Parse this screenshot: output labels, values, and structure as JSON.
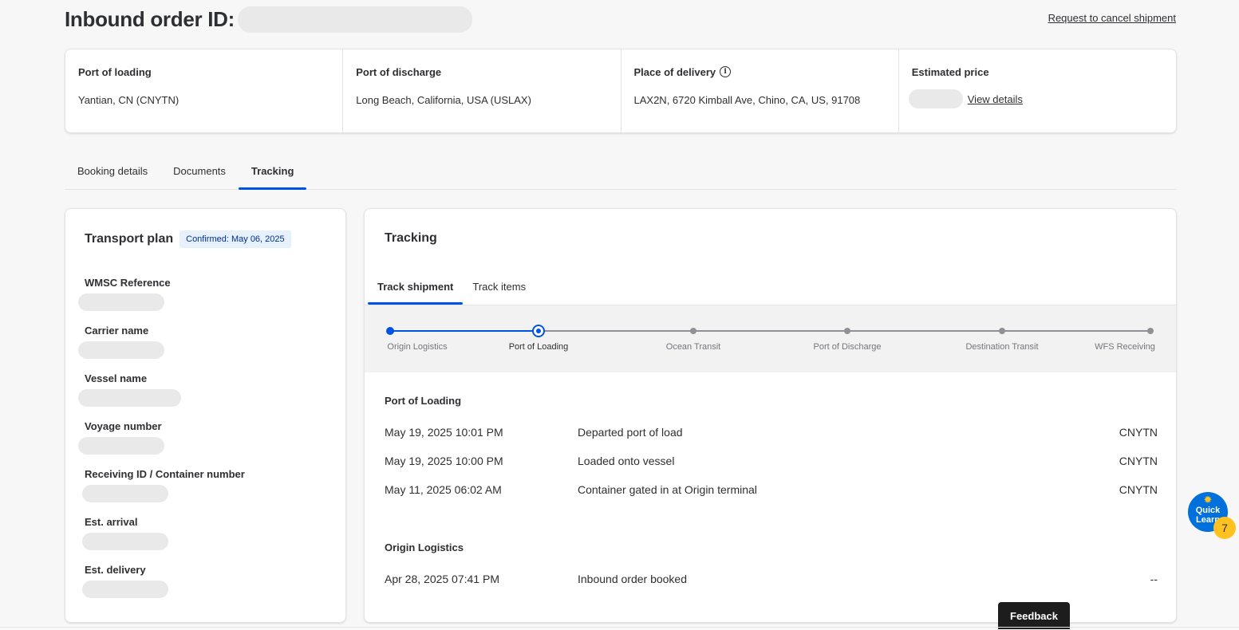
{
  "header": {
    "title": "Inbound order ID:",
    "cancel_link": "Request to cancel shipment"
  },
  "summary": {
    "port_of_loading_label": "Port of loading",
    "port_of_loading_value": "Yantian, CN (CNYTN)",
    "port_of_discharge_label": "Port of discharge",
    "port_of_discharge_value": "Long Beach, California, USA (USLAX)",
    "place_of_delivery_label": "Place of delivery",
    "place_of_delivery_value": "LAX2N, 6720 Kimball Ave, Chino, CA, US, 91708",
    "estimated_price_label": "Estimated price",
    "view_details": "View details"
  },
  "tabs": [
    "Booking details",
    "Documents",
    "Tracking"
  ],
  "active_tab": "Tracking",
  "transport_plan": {
    "title": "Transport plan",
    "badge": "Confirmed: May 06, 2025",
    "fields": [
      "WMSC Reference",
      "Carrier name",
      "Vessel name",
      "Voyage number",
      "Receiving ID / Container number",
      "Est. arrival",
      "Est. delivery"
    ]
  },
  "tracking": {
    "title": "Tracking",
    "tabs": [
      "Track shipment",
      "Track items"
    ],
    "active_tab": "Track shipment",
    "steps": [
      "Origin Logistics",
      "Port of Loading",
      "Ocean Transit",
      "Port of Discharge",
      "Destination Transit",
      "WFS Receiving"
    ],
    "current_step": "Port of Loading",
    "sections": [
      {
        "title": "Port of Loading",
        "events": [
          {
            "date": "May 19, 2025 10:01 PM",
            "description": "Departed port of load",
            "location": "CNYTN"
          },
          {
            "date": "May 19, 2025 10:00 PM",
            "description": "Loaded onto vessel",
            "location": "CNYTN"
          },
          {
            "date": "May 11, 2025 06:02 AM",
            "description": "Container gated in at Origin terminal",
            "location": "CNYTN"
          }
        ]
      },
      {
        "title": "Origin Logistics",
        "events": [
          {
            "date": "Apr 28, 2025 07:41 PM",
            "description": "Inbound order booked",
            "location": "--"
          }
        ]
      }
    ]
  },
  "widgets": {
    "quick_learn_line1": "Quick",
    "quick_learn_line2": "Learn",
    "quick_learn_count": "7",
    "feedback": "Feedback"
  },
  "colors": {
    "accent": "#0053e2",
    "badge_bg": "#e6f1fc",
    "skeleton": "#e9e9e9",
    "quick_learn": "#0071dc",
    "spark": "#ffc220"
  }
}
